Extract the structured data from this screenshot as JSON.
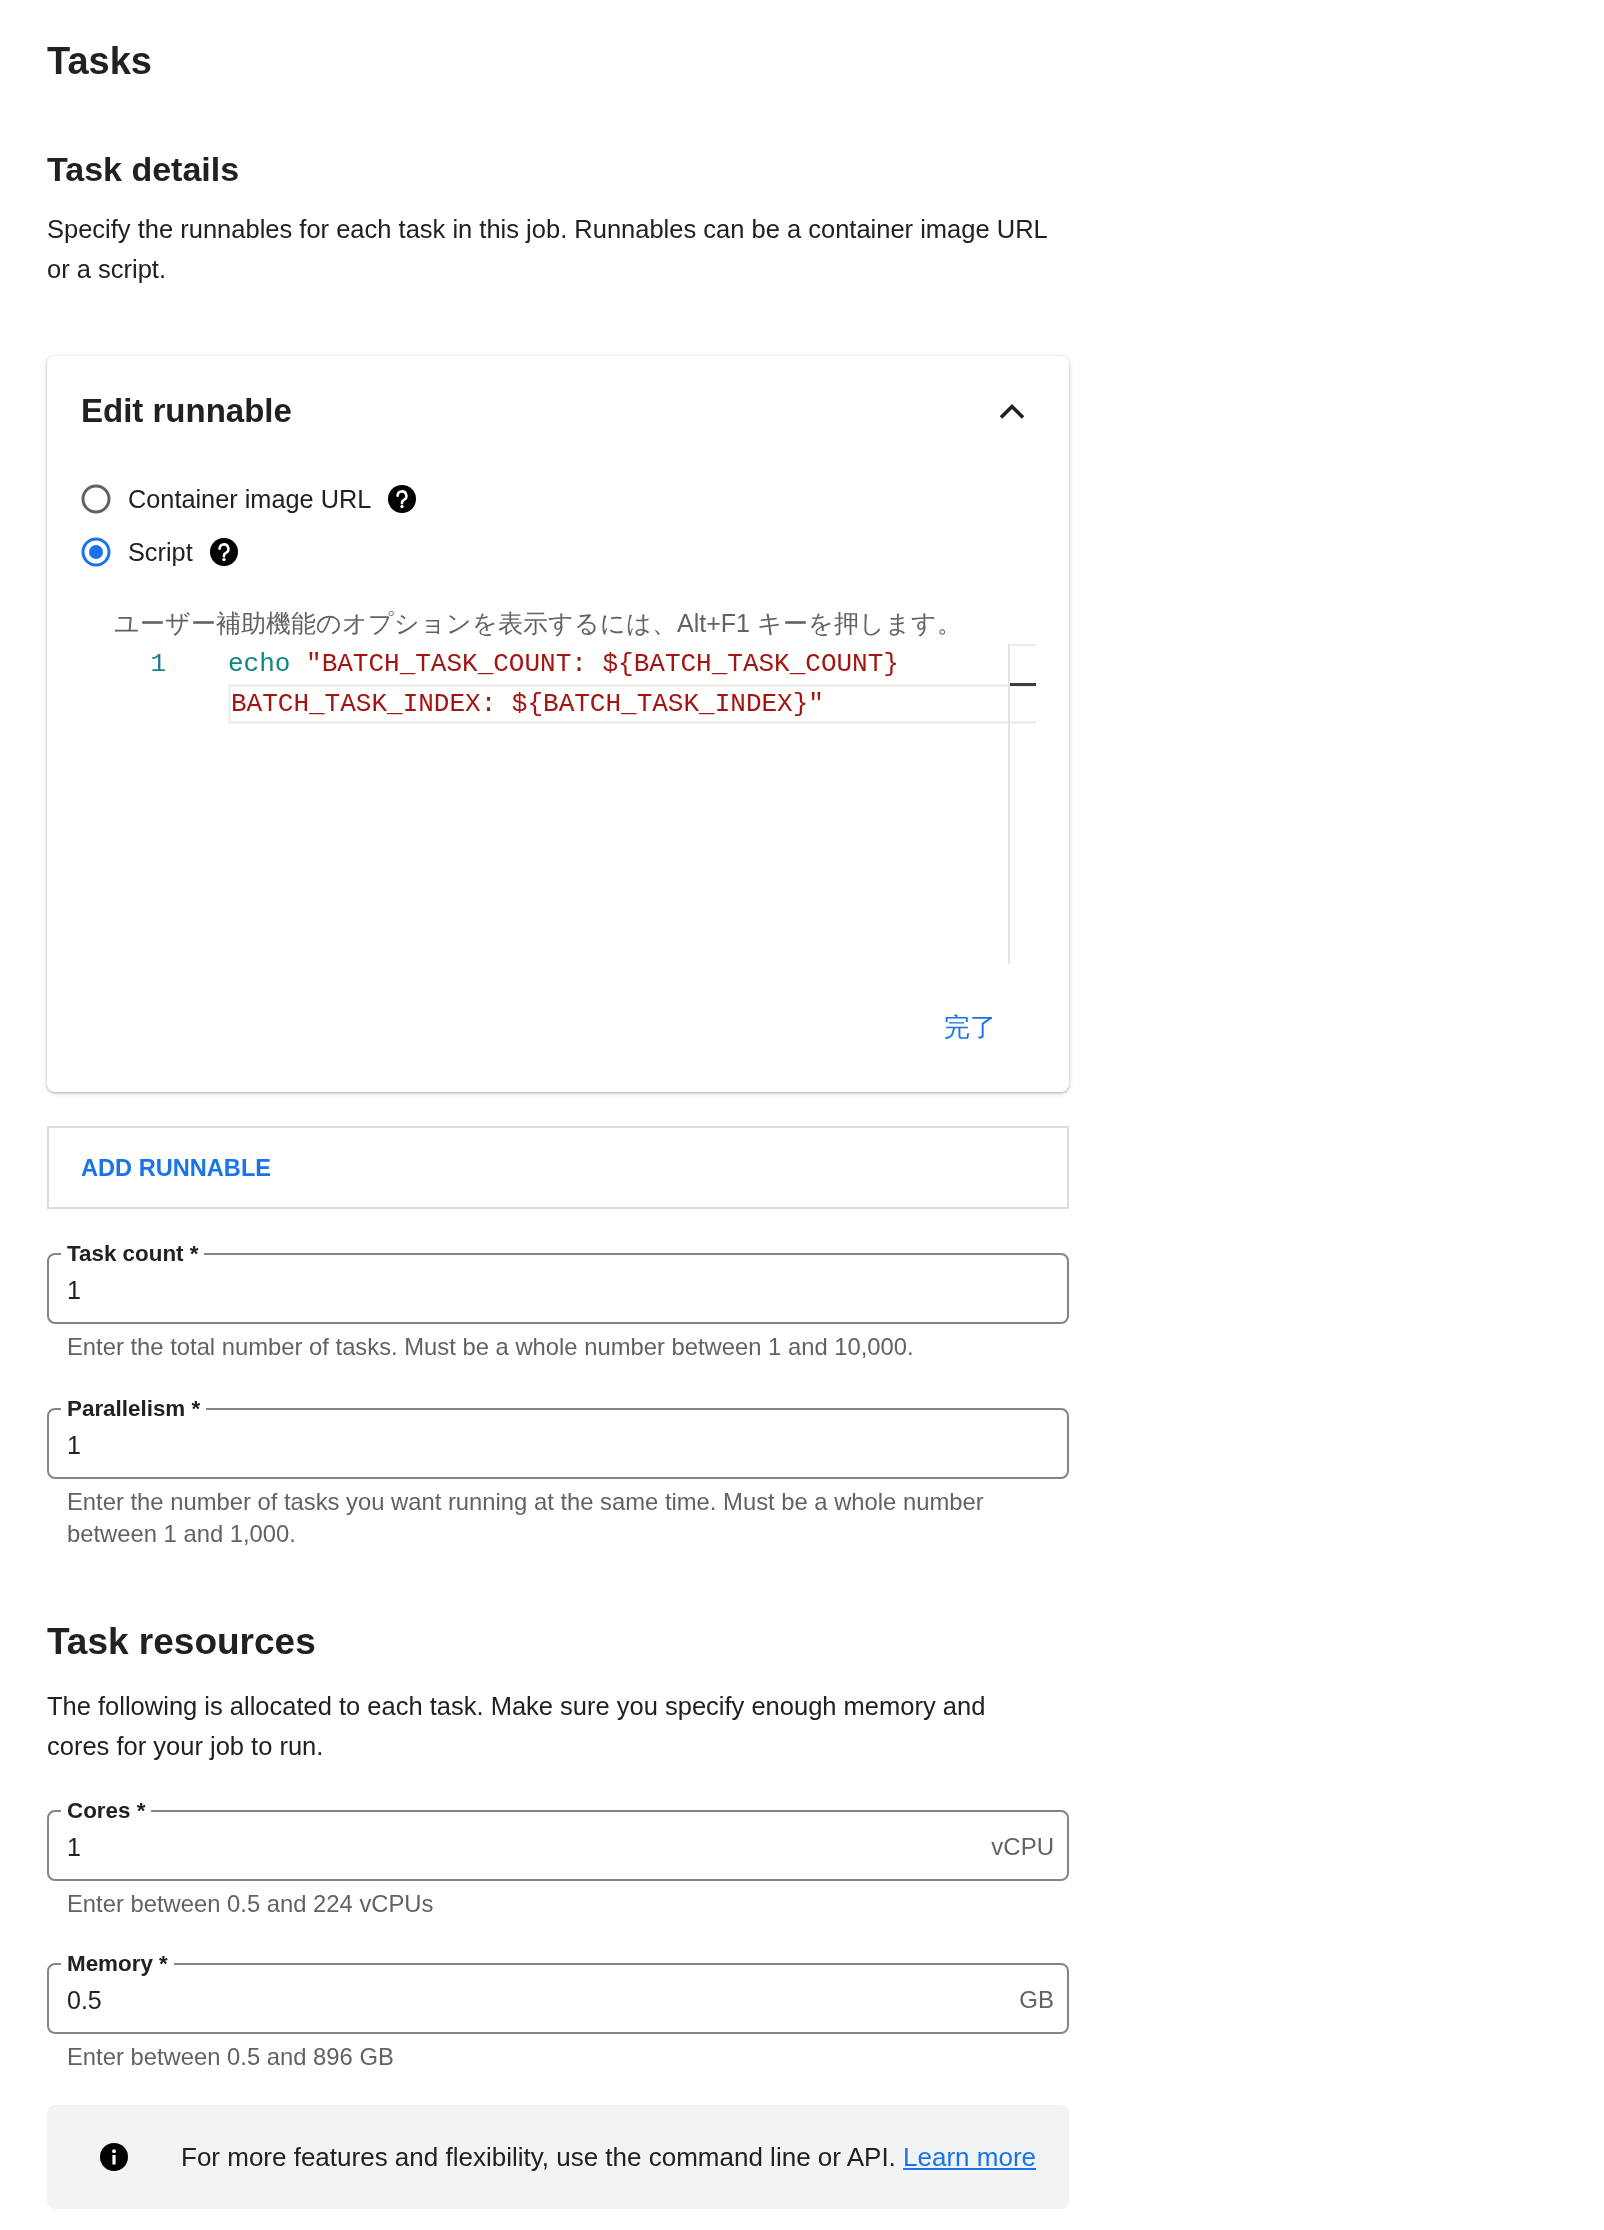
{
  "page": {
    "title": "Tasks"
  },
  "task_details": {
    "heading": "Task details",
    "description": "Specify the runnables for each task in this job. Runnables can be a container image URL or a script.",
    "runnable": {
      "title": "Edit runnable",
      "expanded": true,
      "types": [
        {
          "label": "Container image URL",
          "selected": false
        },
        {
          "label": "Script",
          "selected": true
        }
      ],
      "editor": {
        "hint": "ユーザー補助機能のオプションを表示するには、Alt+F1 キーを押します。",
        "rows": [
          {
            "number": "1",
            "highlighted": false,
            "tokens": [
              {
                "kind": "keyword",
                "text": "echo"
              },
              {
                "kind": "string",
                "text": "\"BATCH_TASK_COUNT: ${BATCH_TASK_COUNT}"
              }
            ]
          },
          {
            "highlighted": true,
            "tokens": [
              {
                "kind": "string",
                "text": "BATCH_TASK_INDEX: ${BATCH_TASK_INDEX}\""
              }
            ]
          }
        ]
      },
      "done_button": "完了"
    },
    "add_button": "ADD RUNNABLE",
    "fields": [
      {
        "label": "Task count *",
        "value": "1",
        "helper": "Enter the total number of tasks. Must be a whole number between 1 and 10,000."
      },
      {
        "label": "Parallelism *",
        "value": "1",
        "helper": "Enter the number of tasks you want running at the same time. Must be a whole number between 1 and 1,000."
      }
    ]
  },
  "task_resources": {
    "heading": "Task resources",
    "description": "The following is allocated to each task. Make sure you specify enough memory and cores for your job to run.",
    "fields": [
      {
        "label": "Cores *",
        "value": "1",
        "suffix": "vCPU",
        "helper": "Enter between 0.5 and 224 vCPUs"
      },
      {
        "label": "Memory *",
        "value": "0.5",
        "suffix": "GB",
        "helper": "Enter between 0.5 and 896 GB"
      }
    ]
  },
  "info_banner": {
    "text": "For more features and flexibility, use the command line or API.",
    "link": "Learn more"
  }
}
